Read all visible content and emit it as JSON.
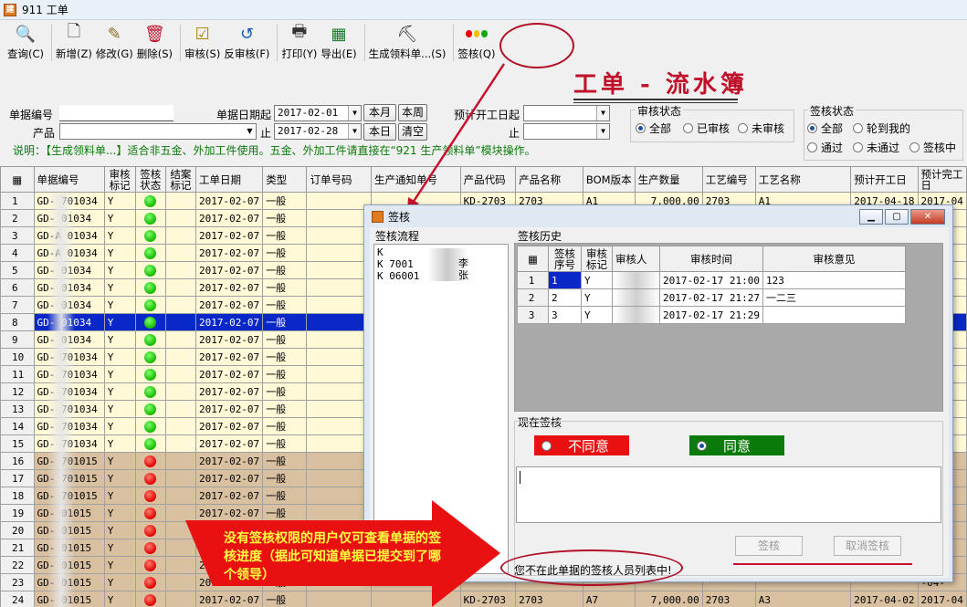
{
  "window": {
    "title": "911 工单"
  },
  "toolbar": [
    {
      "label": "查询(C)",
      "icon": "search-icon"
    },
    {
      "label": "新增(Z)",
      "icon": "new-file-icon"
    },
    {
      "label": "修改(G)",
      "icon": "edit-icon"
    },
    {
      "label": "删除(S)",
      "icon": "trash-icon"
    },
    {
      "label": "审核(S)",
      "icon": "audit-icon"
    },
    {
      "label": "反审核(F)",
      "icon": "unaudit-icon"
    },
    {
      "label": "打印(Y)",
      "icon": "printer-icon"
    },
    {
      "label": "导出(E)",
      "icon": "excel-export-icon"
    },
    {
      "label": "生成领料单...(S)",
      "icon": "material-icon"
    },
    {
      "label": "签核(Q)",
      "icon": "traffic-light-icon"
    }
  ],
  "page_title": "工单 - 流水簿",
  "filters": {
    "doc_no_label": "单据编号",
    "doc_no_value": "",
    "product_label": "产品",
    "product_value": "",
    "date_from_label": "单据日期起",
    "date_from": "2017-02-01",
    "date_to_label": "止",
    "date_to": "2017-02-28",
    "btn_month": "本月",
    "btn_week": "本周",
    "btn_day": "本日",
    "btn_clear": "清空",
    "start_from_label": "预计开工日起",
    "start_from": "",
    "start_to_label": "止",
    "start_to": "",
    "audit_status_label": "审核状态",
    "audit_options": [
      "全部",
      "已审核",
      "未审核"
    ],
    "sign_status_label": "签核状态",
    "sign_options_row1": [
      "全部",
      "轮到我的"
    ],
    "sign_options_row2": [
      "通过",
      "未通过",
      "签核中"
    ],
    "note": "说明：【生成领料单...】适合非五金、外加工件使用。五金、外加工件请直接在“921 生产领料单”模块操作。"
  },
  "grid": {
    "headers": [
      "单据编号",
      "审核标记",
      "签核状态",
      "结案标记",
      "工单日期",
      "类型",
      "订单号码",
      "生产通知单号",
      "产品代码",
      "产品名称",
      "BOM版本",
      "生产数量",
      "工艺编号",
      "工艺名称",
      "预计开工日",
      "预计完工日"
    ],
    "rows": [
      {
        "no": "1",
        "doc": "GD-  701034",
        "audit": "Y",
        "sign": "green",
        "date": "2017-02-07",
        "type": "一般",
        "style": "yel"
      },
      {
        "no": "2",
        "doc": "GD-  01034",
        "audit": "Y",
        "sign": "green",
        "date": "2017-02-07",
        "type": "一般",
        "style": "yel"
      },
      {
        "no": "3",
        "doc": "GD-A  01034",
        "audit": "Y",
        "sign": "green",
        "date": "2017-02-07",
        "type": "一般",
        "style": "yel"
      },
      {
        "no": "4",
        "doc": "GD-A  01034",
        "audit": "Y",
        "sign": "green",
        "date": "2017-02-07",
        "type": "一般",
        "style": "yel"
      },
      {
        "no": "5",
        "doc": "GD-  01034",
        "audit": "Y",
        "sign": "green",
        "date": "2017-02-07",
        "type": "一般",
        "style": "yel"
      },
      {
        "no": "6",
        "doc": "GD-  01034",
        "audit": "Y",
        "sign": "green",
        "date": "2017-02-07",
        "type": "一般",
        "style": "yel"
      },
      {
        "no": "7",
        "doc": "GD-  01034",
        "audit": "Y",
        "sign": "green",
        "date": "2017-02-07",
        "type": "一般",
        "style": "yel"
      },
      {
        "no": "8",
        "doc": "GD-  01034",
        "audit": "Y",
        "sign": "green",
        "date": "2017-02-07",
        "type": "一般",
        "style": "sel"
      },
      {
        "no": "9",
        "doc": "GD-  01034",
        "audit": "Y",
        "sign": "green",
        "date": "2017-02-07",
        "type": "一般",
        "style": "yel"
      },
      {
        "no": "10",
        "doc": "GD-  701034",
        "audit": "Y",
        "sign": "green",
        "date": "2017-02-07",
        "type": "一般",
        "style": "yel"
      },
      {
        "no": "11",
        "doc": "GD-  701034",
        "audit": "Y",
        "sign": "green",
        "date": "2017-02-07",
        "type": "一般",
        "style": "yel"
      },
      {
        "no": "12",
        "doc": "GD-  701034",
        "audit": "Y",
        "sign": "green",
        "date": "2017-02-07",
        "type": "一般",
        "style": "yel"
      },
      {
        "no": "13",
        "doc": "GD-  701034",
        "audit": "Y",
        "sign": "green",
        "date": "2017-02-07",
        "type": "一般",
        "style": "yel"
      },
      {
        "no": "14",
        "doc": "GD-  701034",
        "audit": "Y",
        "sign": "green",
        "date": "2017-02-07",
        "type": "一般",
        "style": "yel"
      },
      {
        "no": "15",
        "doc": "GD-  701034",
        "audit": "Y",
        "sign": "green",
        "date": "2017-02-07",
        "type": "一般",
        "style": "yel"
      },
      {
        "no": "16",
        "doc": "GD-  701015",
        "audit": "Y",
        "sign": "red",
        "date": "2017-02-07",
        "type": "一般",
        "style": "brn"
      },
      {
        "no": "17",
        "doc": "GD-  701015",
        "audit": "Y",
        "sign": "red",
        "date": "2017-02-07",
        "type": "一般",
        "style": "brn"
      },
      {
        "no": "18",
        "doc": "GD-  701015",
        "audit": "Y",
        "sign": "red",
        "date": "2017-02-07",
        "type": "一般",
        "style": "brn"
      },
      {
        "no": "19",
        "doc": "GD-  01015",
        "audit": "Y",
        "sign": "red",
        "date": "2017-02-07",
        "type": "一般",
        "style": "brn"
      },
      {
        "no": "20",
        "doc": "GD-  01015",
        "audit": "Y",
        "sign": "red",
        "date": "2017-02-07",
        "type": "一般",
        "style": "brn"
      },
      {
        "no": "21",
        "doc": "GD-  01015",
        "audit": "Y",
        "sign": "red",
        "date": "2017-02-07",
        "type": "一般",
        "style": "brn"
      },
      {
        "no": "22",
        "doc": "GD-  01015",
        "audit": "Y",
        "sign": "red",
        "date": "2017-02-07",
        "type": "一般",
        "style": "brn"
      },
      {
        "no": "23",
        "doc": "GD-  01015",
        "audit": "Y",
        "sign": "red",
        "date": "2017-02-07",
        "type": "一般",
        "style": "brn"
      },
      {
        "no": "24",
        "doc": "GD-  01015",
        "audit": "Y",
        "sign": "red",
        "date": "2017-02-07",
        "type": "一般",
        "style": "brn"
      }
    ],
    "row1_extra": {
      "product_code": "KD-2703",
      "product_name": "2703",
      "bom": "A1",
      "qty": "7,000.00",
      "proc_no": "2703",
      "proc_name": "A1",
      "start": "2017-04-18",
      "end": "2017-04"
    },
    "row24_extra": {
      "product_code": "KD-2703",
      "product_name": "2703",
      "bom": "A7",
      "qty": "7,000.00",
      "proc_no": "2703",
      "proc_name": "A3",
      "start": "2017-04-02",
      "end": "2017-04"
    },
    "right_edge": "-04-"
  },
  "dialog": {
    "title": "签核",
    "flow_label": "签核流程",
    "flow_items": [
      "K",
      "K  7001",
      "K  06001"
    ],
    "flow_names": [
      "李",
      "张"
    ],
    "history_label": "签核历史",
    "history_headers": [
      "签核序号",
      "审核标记",
      "审核人",
      "审核时间",
      "审核意见"
    ],
    "history_rows": [
      {
        "n": "1",
        "seq": "1",
        "flag": "Y",
        "who": "",
        "time": "2017-02-17 21:00",
        "opinion": "123"
      },
      {
        "n": "2",
        "seq": "2",
        "flag": "Y",
        "who": "",
        "time": "2017-02-17 21:27",
        "opinion": "一二三"
      },
      {
        "n": "3",
        "seq": "3",
        "flag": "Y",
        "who": "",
        "time": "2017-02-17 21:29",
        "opinion": ""
      }
    ],
    "current_label": "现在签核",
    "disagree": "不同意",
    "agree": "同意",
    "btn_sign": "签核",
    "btn_cancel": "取消签核",
    "status_msg": "您不在此单据的签核人员列表中!"
  },
  "callout": "没有签核权限的用户仅可查看单据的签核进度（据此可知道单据已提交到了哪个领导）",
  "colors": {
    "accent_red": "#c8102e",
    "title_red": "#c0102a",
    "row_yellow": "#fff9d7",
    "row_brown": "#d9c0a0",
    "selected": "#0a28c8",
    "disagree_bg": "#e81010",
    "agree_bg": "#0a7a0a"
  }
}
